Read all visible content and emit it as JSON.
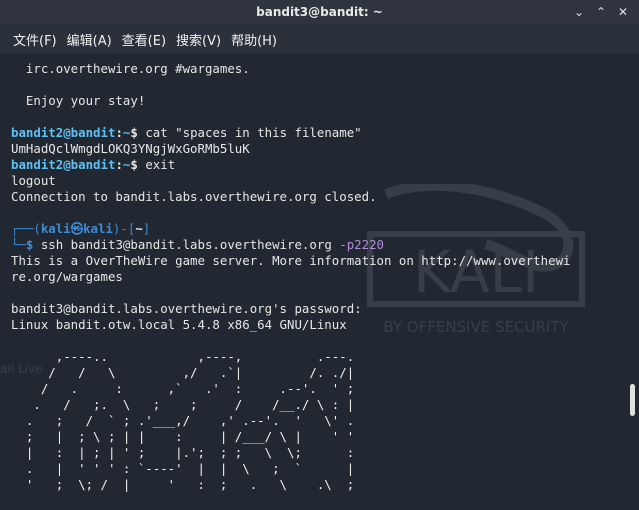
{
  "window": {
    "title": "bandit3@bandit: ~"
  },
  "menu": [
    "文件(F)",
    "编辑(A)",
    "查看(E)",
    "搜索(V)",
    "帮助(H)"
  ],
  "terminal": {
    "lines": [
      "  irc.overthewire.org #wargames.",
      "",
      "  Enjoy your stay!",
      "",
      "cat \"spaces in this filename\"",
      "UmHadQclWmgdLOKQ3YNgjWxGoRMb5luK",
      "exit",
      "logout",
      "Connection to bandit.labs.overthewire.org closed.",
      "",
      "",
      "ssh bandit3@bandit.labs.overthewire.org",
      "This is a OverTheWire game server. More information on http://www.overthewi",
      "re.org/wargames",
      "",
      "bandit3@bandit.labs.overthewire.org's password:",
      "Linux bandit.otw.local 5.4.8 x86_64 GNU/Linux",
      "",
      "      ,----..            ,----,          .---.",
      "     /   /   \\         ,/   .`|         /. ./|",
      "    /   .     :      ,`   .'  :     .--'.  ' ;",
      "   .   /   ;.  \\   ;    ;     /    /__./ \\ : |",
      "  .   ;   /  ` ; .'___,/    ,' .--'.  '   \\' .",
      "  ;   |  ; \\ ; | |    :     | /___/ \\ |    ' '",
      "  |   :  | ; | ' ;    |.';  ; ;   \\  \\;      :",
      "  .   |  ' ' ' : `----'  |  |  \\   ;  `      |",
      "  '   ;  \\; /  |     '   :  ;   .   \\    .\\  ;"
    ],
    "prompt_user": "bandit2@bandit",
    "prompt_sep": ":",
    "prompt_dir": "~",
    "prompt_symbol": "$",
    "zsh_user": "kali",
    "zsh_at": "㉿",
    "zsh_host": "kali",
    "zsh_dir": "~",
    "ssh_port_arg": " -p2220",
    "watermark_text": "KALI",
    "watermark_sub": "BY OFFENSIVE SECURITY"
  },
  "desktop_ghost": [
    "ail Live"
  ]
}
